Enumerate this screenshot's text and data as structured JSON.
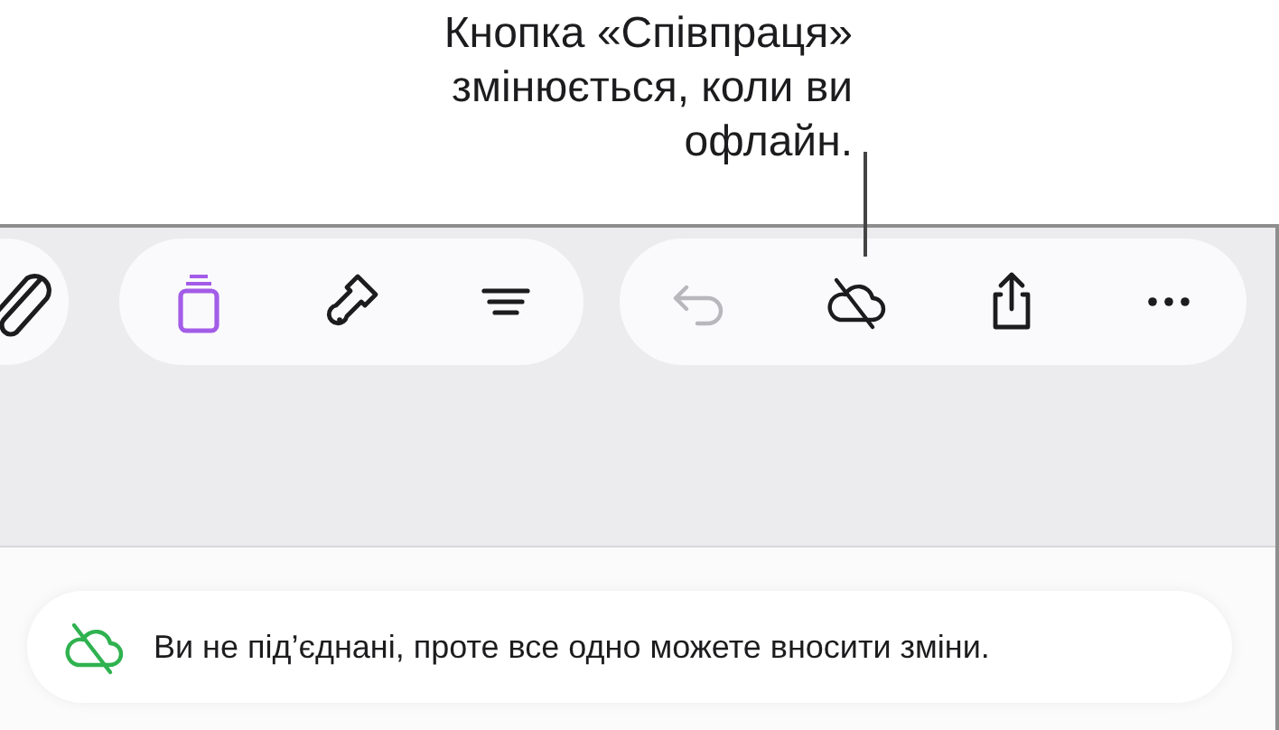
{
  "callout": {
    "text": "Кнопка «Співпраця» змінюється, коли ви офлайн."
  },
  "toolbar": {
    "left_group": [
      {
        "kind": "paperclip"
      }
    ],
    "format_group": [
      {
        "kind": "document",
        "selected": true
      },
      {
        "kind": "brush",
        "selected": false
      },
      {
        "kind": "align",
        "selected": false
      }
    ],
    "actions_group": [
      {
        "kind": "undo",
        "disabled": true
      },
      {
        "kind": "cloud-offline",
        "disabled": false
      },
      {
        "kind": "share",
        "disabled": false
      },
      {
        "kind": "more",
        "disabled": false
      }
    ]
  },
  "banner": {
    "text": "Ви не під’єднані, проте все одно можете вносити зміни."
  }
}
